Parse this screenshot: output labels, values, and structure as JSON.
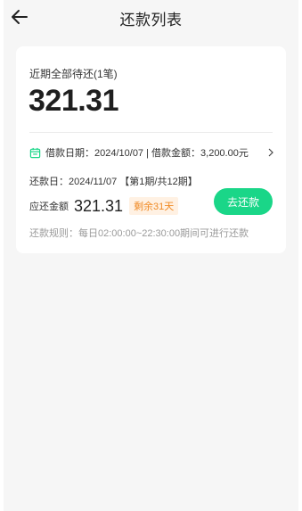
{
  "header": {
    "title": "还款列表",
    "back_icon": "arrow-left-icon"
  },
  "card": {
    "summary_label": "近期全部待还(1笔)",
    "summary_amount": "321.31",
    "loan_info": "借款日期：2024/10/07 | 借款金额：3,200.00元",
    "calendar_icon": "calendar-icon",
    "chevron_icon": "chevron-right-icon",
    "repay_date": "还款日：2024/11/07 【第1期/共12期】",
    "due_label": "应还金额",
    "due_amount": "321.31",
    "remaining_badge": "剩余31天",
    "pay_button": "去还款",
    "rule_text": "还款规则：每日02:00:00~22:30:00期间可进行还款"
  },
  "colors": {
    "accent": "#1ad688",
    "badge_text": "#f08a24",
    "badge_bg": "#fff1e3",
    "page_bg": "#f6f6f6"
  }
}
